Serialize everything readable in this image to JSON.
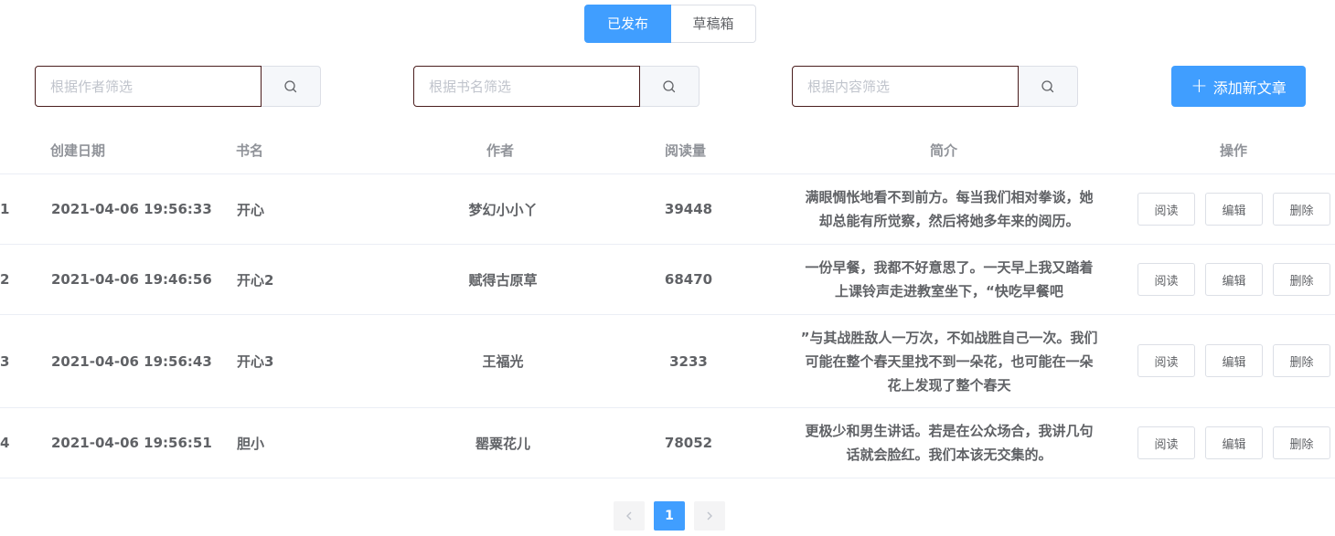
{
  "tabs": [
    {
      "label": "已发布",
      "active": true
    },
    {
      "label": "草稿箱",
      "active": false
    }
  ],
  "search": {
    "author_placeholder": "根据作者筛选",
    "book_placeholder": "根据书名筛选",
    "content_placeholder": "根据内容筛选",
    "icon": "search-icon"
  },
  "add_button": {
    "icon": "plus-icon",
    "plus": "+",
    "label": "添加新文章"
  },
  "table": {
    "headers": {
      "date": "创建日期",
      "book": "书名",
      "author": "作者",
      "reads": "阅读量",
      "intro": "简介",
      "ops": "操作"
    },
    "rows": [
      {
        "index": "1",
        "date": "2021-04-06 19:56:33",
        "book": "开心",
        "author": "梦幻小小丫",
        "reads": "39448",
        "intro_lines": [
          "满眼惆怅地看不到前方。每当我们相对拳谈，她",
          "却总能有所觉察，然后将她多年来的阅历。"
        ]
      },
      {
        "index": "2",
        "date": "2021-04-06 19:46:56",
        "book": "开心2",
        "author": "赋得古原草",
        "reads": "68470",
        "intro_lines": [
          "一份早餐，我都不好意思了。一天早上我又踏着",
          "上课铃声走进教室坐下，“快吃早餐吧"
        ]
      },
      {
        "index": "3",
        "date": "2021-04-06 19:56:43",
        "book": "开心3",
        "author": "王福光",
        "reads": "3233",
        "intro_lines": [
          "”与其战胜敌人一万次，不如战胜自己一次。我们",
          "可能在整个春天里找不到一朵花，也可能在一朵",
          "花上发现了整个春天"
        ]
      },
      {
        "index": "4",
        "date": "2021-04-06 19:56:51",
        "book": "胆小",
        "author": "罂粟花儿",
        "reads": "78052",
        "intro_lines": [
          "更极少和男生讲话。若是在公众场合，我讲几句",
          "话就会脸红。我们本该无交集的。"
        ]
      }
    ],
    "actions": {
      "read": "阅读",
      "edit": "编辑",
      "delete": "删除"
    }
  },
  "pagination": {
    "prev_icon": "chevron-left-icon",
    "current": "1",
    "next_icon": "chevron-right-icon"
  },
  "colors": {
    "primary": "#409eff",
    "border": "#dcdfe6",
    "text": "#606266",
    "header_text": "#909399"
  }
}
